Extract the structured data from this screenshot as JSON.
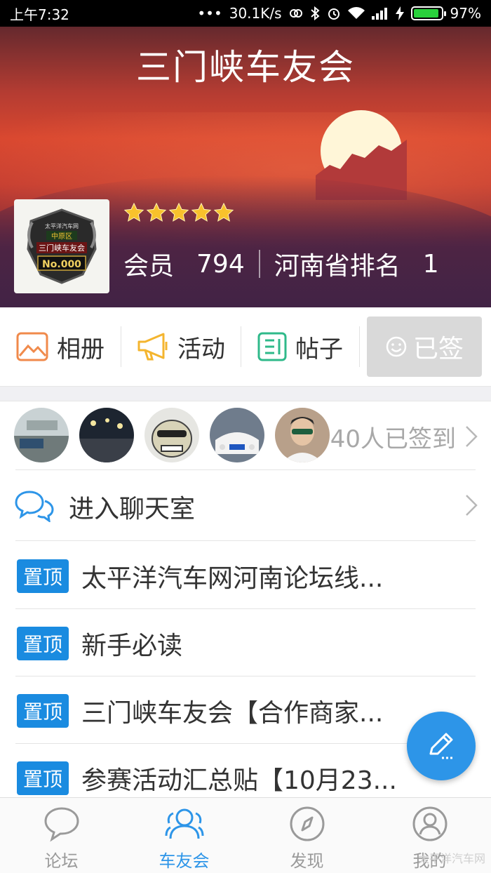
{
  "status_bar": {
    "time": "上午7:32",
    "speed": "30.1K/s",
    "battery": "97%",
    "battery_level": 0.97
  },
  "header": {
    "title": "三门峡车友会"
  },
  "club": {
    "logo_text": {
      "line1": "太平洋汽车网",
      "line2": "中原区",
      "line3": "三门峡车友会",
      "line4": "No.000"
    },
    "rating_stars": 5,
    "members_label": "会员",
    "members_count": "794",
    "rank_label": "河南省排名",
    "rank_value": "1"
  },
  "actions": {
    "album": "相册",
    "events": "活动",
    "posts": "帖子",
    "signed": "已签"
  },
  "checkin": {
    "text": "40人已签到"
  },
  "chat": {
    "label": "进入聊天室"
  },
  "pinned_posts": [
    {
      "badge": "置顶",
      "title": "太平洋汽车网河南论坛线..."
    },
    {
      "badge": "置顶",
      "title": "新手必读"
    },
    {
      "badge": "置顶",
      "title": "三门峡车友会【合作商家..."
    },
    {
      "badge": "置顶",
      "title": "参赛活动汇总贴【10月23..."
    }
  ],
  "tabs": [
    {
      "label": "论坛"
    },
    {
      "label": "车友会"
    },
    {
      "label": "发现"
    },
    {
      "label": "我的"
    }
  ],
  "watermark": "太平洋汽车网",
  "colors": {
    "accent": "#2d95e8",
    "badge": "#1a8be0",
    "star": "#f8c22c"
  }
}
